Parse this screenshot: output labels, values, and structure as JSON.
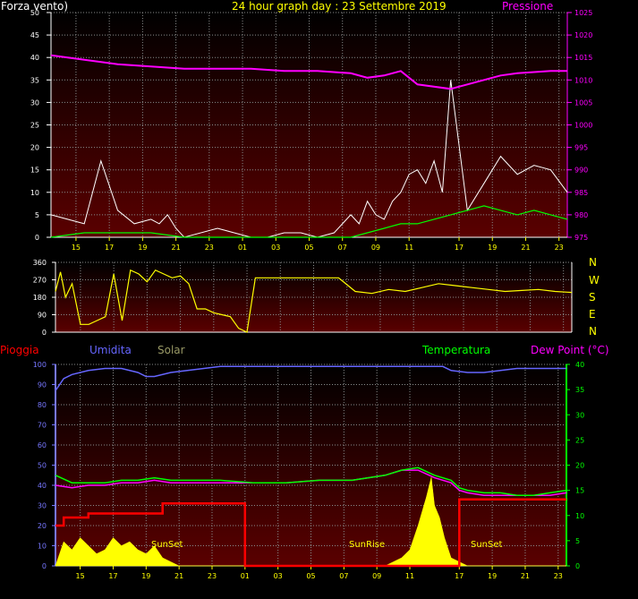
{
  "header": {
    "title": "24 hour graph day : 23 Settembre 2019",
    "left_label": "Forza vento)",
    "right_label": "Pressione"
  },
  "panel2": {
    "compass": [
      "N",
      "W",
      "S",
      "E",
      "N"
    ]
  },
  "panel3": {
    "legend": {
      "rain": "Pioggia",
      "humidity": "Umidita",
      "solar": "Solar",
      "temperature": "Temperatura",
      "dewpoint": "Dew Point (°C)"
    },
    "annotations": [
      "SunSet",
      "SunRise",
      "SunSet"
    ]
  },
  "colors": {
    "title": "#ffff00",
    "pressure": "#ff00ff",
    "wind": "#ffffff",
    "wind_avg": "#00ff00",
    "direction": "#ffff00",
    "rain": "#ff0000",
    "humidity": "#6666ff",
    "solar": "#ffff00",
    "temperature": "#00ff00",
    "dewpoint": "#ff00ff",
    "legend_solar": "#999966",
    "axis_left": "#7777ff",
    "axis_right": "#00ff00"
  },
  "chart_data": [
    {
      "type": "line",
      "title": "24 hour graph day : 23 Settembre 2019",
      "x_tick_labels": [
        "15",
        "17",
        "19",
        "21",
        "23",
        "01",
        "03",
        "05",
        "07",
        "09",
        "11",
        "17",
        "19",
        "21",
        "23"
      ],
      "y_left": {
        "label": "Forza vento)",
        "range": [
          0,
          50
        ],
        "ticks": [
          0,
          5,
          10,
          15,
          20,
          25,
          30,
          35,
          40,
          45,
          50
        ]
      },
      "y_right": {
        "label": "Pressione",
        "range": [
          975,
          1025
        ],
        "ticks": [
          975,
          980,
          985,
          990,
          995,
          1000,
          1005,
          1010,
          1015,
          1020,
          1025
        ]
      },
      "series": [
        {
          "name": "Pressione",
          "axis": "right",
          "hours": [
            0,
            2,
            4,
            6,
            8,
            10,
            12,
            14,
            16,
            18,
            19,
            20,
            21,
            22,
            24,
            25,
            26,
            27,
            28,
            30,
            31
          ],
          "values": [
            1015.5,
            1014.5,
            1013.5,
            1013,
            1012.5,
            1012.5,
            1012.5,
            1012,
            1012,
            1011.5,
            1010.5,
            1011,
            1012,
            1009,
            1008,
            1009,
            1010,
            1011,
            1011.5,
            1012,
            1012
          ]
        },
        {
          "axis": "left",
          "hours": [
            0,
            1,
            2,
            3,
            4,
            5,
            6,
            6.5,
            7,
            7.5,
            8,
            10,
            11,
            12,
            13,
            14,
            15,
            16,
            17,
            17.5,
            18,
            18.5,
            19,
            19.5,
            20,
            20.5,
            21,
            21.5,
            22,
            22.5,
            23,
            23.5,
            24,
            25,
            26,
            27,
            28,
            29,
            30,
            31
          ],
          "values": [
            5,
            4,
            3,
            17,
            6,
            3,
            4,
            3,
            5,
            2,
            0,
            2,
            1,
            0,
            0,
            1,
            1,
            0,
            1,
            3,
            5,
            3,
            8,
            5,
            4,
            8,
            10,
            14,
            15,
            12,
            17,
            10,
            35,
            6,
            12,
            18,
            14,
            16,
            15,
            10
          ]
        },
        {
          "axis": "left",
          "hours": [
            0,
            2,
            4,
            6,
            8,
            10,
            12,
            14,
            16,
            18,
            19,
            20,
            21,
            22,
            23,
            24,
            25,
            26,
            27,
            28,
            29,
            30,
            31
          ],
          "values": [
            0,
            1,
            1,
            1,
            0,
            0,
            0,
            0,
            0,
            0,
            1,
            2,
            3,
            3,
            4,
            5,
            6,
            7,
            6,
            5,
            6,
            5,
            4
          ]
        }
      ]
    },
    {
      "type": "line",
      "y_range": [
        0,
        360
      ],
      "y_ticks": [
        0,
        90,
        180,
        270,
        360
      ],
      "series": [
        {
          "axis": "left",
          "hours": [
            0,
            0.3,
            0.6,
            1,
            1.5,
            2,
            2.5,
            3,
            3.5,
            4,
            4.5,
            5,
            5.5,
            6,
            6.5,
            7,
            7.5,
            8,
            8.5,
            9,
            9.5,
            10,
            10.5,
            11,
            11.5,
            12,
            12.5,
            13,
            14,
            15,
            16,
            17,
            18,
            19,
            20,
            21,
            22,
            23,
            24,
            25,
            26,
            27,
            28,
            29,
            30,
            31
          ],
          "values": [
            210,
            310,
            180,
            250,
            40,
            40,
            60,
            80,
            300,
            60,
            320,
            300,
            260,
            320,
            300,
            280,
            290,
            250,
            120,
            120,
            100,
            90,
            80,
            20,
            0,
            280,
            280,
            280,
            280,
            280,
            280,
            280,
            210,
            200,
            220,
            210,
            230,
            250,
            240,
            230,
            220,
            210,
            215,
            220,
            210,
            205
          ]
        }
      ]
    },
    {
      "type": "line",
      "x_tick_labels": [
        "15",
        "17",
        "19",
        "21",
        "23",
        "01",
        "03",
        "05",
        "07",
        "09",
        "11",
        "17",
        "19",
        "21",
        "23"
      ],
      "y_left": {
        "range": [
          0,
          100
        ],
        "ticks": [
          0,
          10,
          20,
          30,
          40,
          50,
          60,
          70,
          80,
          90,
          100
        ]
      },
      "y_right": {
        "range": [
          0,
          40
        ],
        "ticks": [
          0,
          5,
          10,
          15,
          20,
          25,
          30,
          35,
          40
        ]
      },
      "series": [
        {
          "name": "Umidita",
          "axis": "left",
          "hours": [
            0,
            0.5,
            1,
            2,
            3,
            4,
            5,
            5.5,
            6,
            7,
            8,
            9,
            10,
            12,
            14,
            16,
            18,
            20,
            22,
            23.5,
            24,
            25,
            26,
            27,
            28,
            30,
            31
          ],
          "values": [
            87,
            93,
            95,
            97,
            98,
            98,
            96,
            94,
            94,
            96,
            97,
            98,
            99,
            99,
            99,
            99,
            99,
            99,
            99,
            99,
            97,
            96,
            96,
            97,
            98,
            98,
            98
          ]
        },
        {
          "name": "Temperatura",
          "axis": "right",
          "hours": [
            0,
            1,
            2,
            3,
            4,
            5,
            6,
            7,
            8,
            9,
            10,
            12,
            14,
            16,
            18,
            20,
            21,
            22,
            23,
            24,
            24.5,
            25,
            26,
            27,
            28,
            29,
            30,
            31
          ],
          "values": [
            18,
            16.5,
            16.5,
            16.5,
            17,
            17,
            17.5,
            17,
            17,
            17,
            17,
            16.5,
            16.5,
            17,
            17,
            18,
            19,
            19.5,
            18,
            17,
            15.5,
            15,
            14.5,
            14.5,
            14,
            14,
            14.5,
            15
          ]
        },
        {
          "name": "Dew Point (°C)",
          "axis": "right",
          "hours": [
            0,
            1,
            2,
            3,
            4,
            5,
            6,
            7,
            8,
            9,
            10,
            12,
            14,
            16,
            18,
            20,
            21,
            22,
            23,
            24,
            24.5,
            25,
            26,
            27,
            28,
            29,
            30,
            31
          ],
          "values": [
            16,
            15.5,
            16,
            16,
            16.5,
            16.5,
            17,
            16.5,
            16.5,
            16.5,
            16.5,
            16.5,
            16.5,
            17,
            17,
            18,
            19,
            19,
            17.5,
            16.5,
            15,
            14.5,
            14,
            14,
            14,
            14,
            14,
            14.5
          ]
        },
        {
          "name": "Pioggia",
          "axis": "left",
          "step": true,
          "hours": [
            0,
            0.5,
            2,
            6.5,
            11.5,
            11.5,
            24,
            24.5,
            24.5,
            31
          ],
          "values": [
            20,
            24,
            26,
            31,
            31,
            0,
            0,
            12,
            33,
            33
          ]
        },
        {
          "name": "Solar",
          "axis": "left",
          "area": true,
          "hours": [
            0,
            0.5,
            1,
            1.5,
            2,
            2.5,
            3,
            3.5,
            4,
            4.5,
            5,
            5.5,
            6,
            6.5,
            7,
            7.5,
            8,
            8.5,
            9,
            9.5,
            20,
            20.5,
            21,
            21.5,
            22,
            22.5,
            22.8,
            23,
            23.3,
            23.6,
            24,
            24.5,
            25,
            31
          ],
          "values": [
            0,
            12,
            8,
            14,
            10,
            6,
            8,
            14,
            10,
            12,
            8,
            6,
            10,
            4,
            2,
            0,
            0,
            0,
            0,
            0,
            0,
            2,
            4,
            8,
            20,
            34,
            44,
            30,
            24,
            14,
            4,
            2,
            0,
            0
          ]
        }
      ]
    }
  ]
}
